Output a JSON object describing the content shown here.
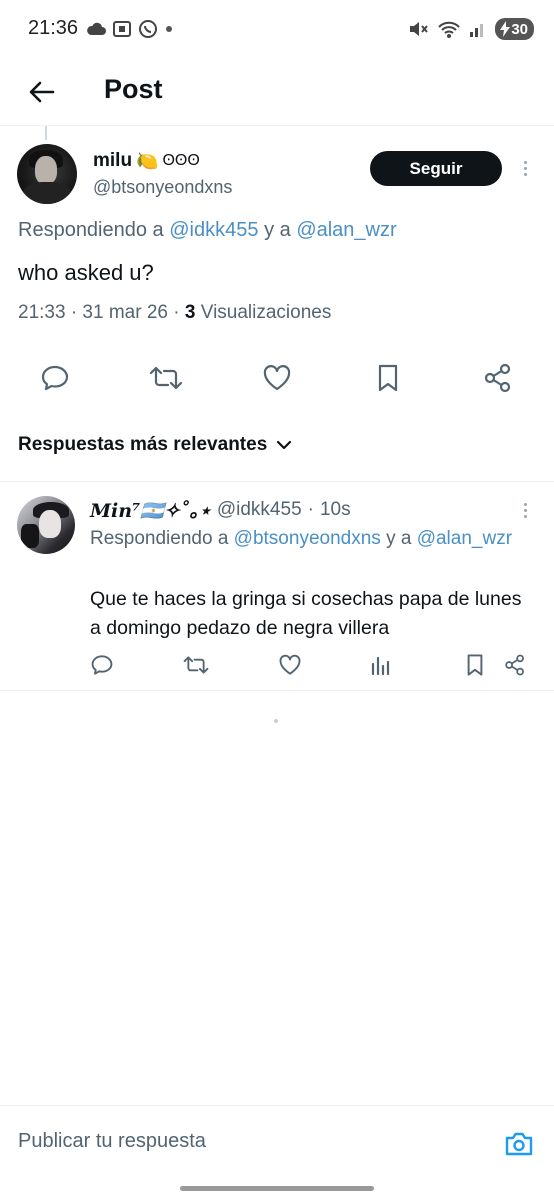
{
  "status_bar": {
    "time": "21:36",
    "battery": "30",
    "icons_left": [
      "cloud-icon",
      "screenshot-icon",
      "whatsapp-icon",
      "dot-icon"
    ],
    "icons_right": [
      "mute-icon",
      "wifi-icon",
      "signal-icon",
      "battery-icon"
    ]
  },
  "header": {
    "title": "Post"
  },
  "post": {
    "author_name": "milu",
    "author_emoji": "🍋",
    "author_symbols": "ʘʘʘ",
    "handle": "@btsonyeondxns",
    "follow_label": "Seguir",
    "replying_prefix": "Respondiendo a",
    "replying_user1": "@idkk455",
    "replying_joiner": "y a",
    "replying_user2": "@alan_wzr",
    "text": "who asked u?",
    "meta_prefix": "21:33 · 31 mar 26 ·",
    "views_count": "3",
    "views_label": "Visualizaciones"
  },
  "sort": {
    "label": "Respuestas más relevantes"
  },
  "reply": {
    "author_name": "𝑴in⁷🇦🇷✧˚｡⋆",
    "handle": "@idkk455",
    "separator": "·",
    "time": "10s",
    "replying_prefix": "Respondiendo a",
    "replying_user1": "@btsonyeondxns",
    "replying_joiner": "y a",
    "replying_user2": "@alan_wzr",
    "text": "Que te haces la gringa si cosechas papa de lunes a domingo pedazo de negra villera"
  },
  "composer": {
    "placeholder": "Publicar tu respuesta"
  },
  "colors": {
    "text_primary": "#0f1419",
    "text_secondary": "#536471",
    "link": "#4a8fc6",
    "divider": "#eff3f4"
  }
}
